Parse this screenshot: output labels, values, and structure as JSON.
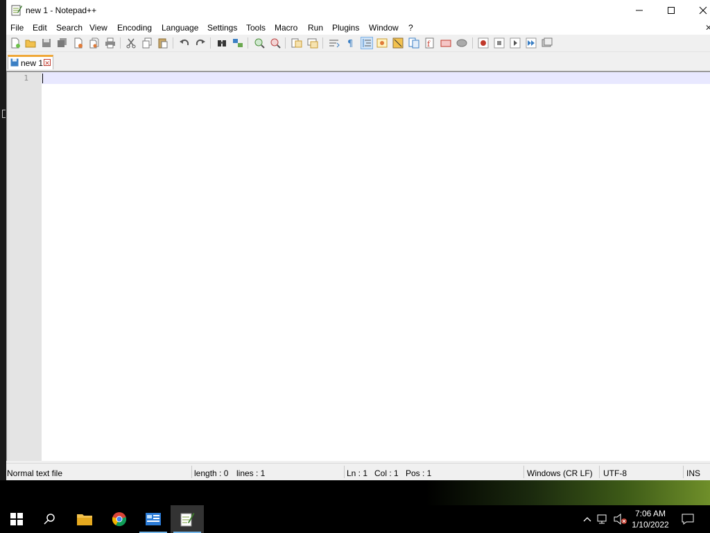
{
  "window": {
    "title": "new 1 - Notepad++",
    "controls": {
      "minimize": "—",
      "maximize": "☐",
      "close": "✕"
    }
  },
  "menu": {
    "items": [
      "File",
      "Edit",
      "Search",
      "View",
      "Encoding",
      "Language",
      "Settings",
      "Tools",
      "Macro",
      "Run",
      "Plugins",
      "Window",
      "?"
    ],
    "close_doc": "✕"
  },
  "toolbar": {
    "buttons": [
      "new-file",
      "open-file",
      "save",
      "save-all",
      "close",
      "close-all",
      "print",
      "cut",
      "copy",
      "paste",
      "undo",
      "redo",
      "find",
      "replace",
      "zoom-in",
      "zoom-out",
      "sync-vertical",
      "sync-horizontal",
      "word-wrap",
      "show-all-characters",
      "indent-guide",
      "user-defined-language",
      "document-map",
      "function-list",
      "folder-as-workspace",
      "monitoring",
      "record-macro",
      "stop-recording",
      "playback-macro",
      "run-macro-multiple",
      "save-macro"
    ],
    "active": "indent-guide"
  },
  "tabs": [
    {
      "label": "new 1",
      "close": "✕"
    }
  ],
  "editor": {
    "line_numbers": [
      "1"
    ],
    "content": ""
  },
  "status": {
    "file_type": "Normal text file",
    "length": "length : 0",
    "lines": "lines : 1",
    "ln": "Ln : 1",
    "col": "Col : 1",
    "pos": "Pos : 1",
    "eol": "Windows (CR LF)",
    "encoding": "UTF-8",
    "mode": "INS"
  },
  "taskbar": {
    "apps": [
      "start",
      "search",
      "file-explorer",
      "chrome",
      "server-manager",
      "notepad-plus-plus"
    ],
    "active": "notepad-plus-plus",
    "clock_time": "7:06 AM",
    "clock_date": "1/10/2022"
  },
  "colors": {
    "tab_accent": "#f0a838",
    "current_line": "#e8e8ff",
    "taskbar_underline": "#76b9ed"
  }
}
